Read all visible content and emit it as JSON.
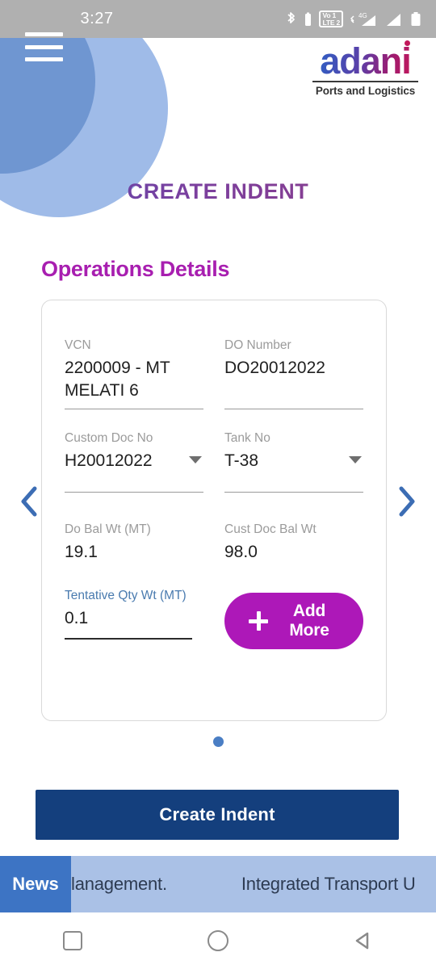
{
  "status_bar": {
    "time": "3:27",
    "icons": [
      "bluetooth-icon",
      "bluetooth-battery-icon",
      "volte-dual-sim-icon",
      "mobile-data-4g-icon",
      "signal-bars-icon",
      "battery-icon"
    ],
    "volte_top": "Vo 1",
    "volte_bottom": "LTE 2",
    "network_label": "4G",
    "background": "#b0b0b0"
  },
  "header": {
    "menu_icon": "hamburger-menu-icon",
    "logo_word": "adani",
    "logo_subtitle": "Ports and Logistics",
    "page_title": "CREATE INDENT",
    "circle_light_color": "#9fbbe8",
    "circle_dark_color": "#6f96d1"
  },
  "section": {
    "heading": "Operations Details",
    "heading_color": "#a81fb0"
  },
  "carousel": {
    "prev_icon": "chevron-left-icon",
    "next_icon": "chevron-right-icon",
    "arrow_color": "#3c6db4",
    "dot_count": 1,
    "active_dot": 0,
    "dot_color": "#4a7ec4"
  },
  "form": {
    "fields": [
      {
        "label": "VCN",
        "value": "2200009 - MT\nMELATI 6",
        "type": "text",
        "underline": true,
        "state": "filled"
      },
      {
        "label": "DO Number",
        "value": "DO20012022",
        "type": "text",
        "underline": true,
        "state": "filled"
      },
      {
        "label": "Custom Doc No",
        "value": "H20012022",
        "type": "select",
        "underline": true,
        "state": "filled"
      },
      {
        "label": "Tank No",
        "value": "T-38",
        "type": "select",
        "underline": true,
        "state": "filled"
      },
      {
        "label": "Do Bal Wt (MT)",
        "value": "19.1",
        "type": "readonly",
        "underline": false,
        "state": "readonly"
      },
      {
        "label": "Cust Doc Bal Wt",
        "value": "98.0",
        "type": "readonly",
        "underline": false,
        "state": "readonly"
      },
      {
        "label": "Tentative Qty Wt (MT)",
        "value": "0.1",
        "type": "text",
        "underline": true,
        "state": "focused"
      }
    ],
    "add_more_label": "Add More",
    "add_more_icon": "plus-icon",
    "add_more_color": "#ad18b8"
  },
  "actions": {
    "primary_label": "Create Indent",
    "primary_color": "#143f7d"
  },
  "ticker": {
    "badge_label": "News",
    "badge_color": "#3d74c4",
    "background": "#aac1e6",
    "items": [
      "lanagement.",
      "Integrated Transport U"
    ]
  },
  "navigation": {
    "recents_icon": "square-recents-icon",
    "home_icon": "circle-home-icon",
    "back_icon": "triangle-back-icon"
  }
}
